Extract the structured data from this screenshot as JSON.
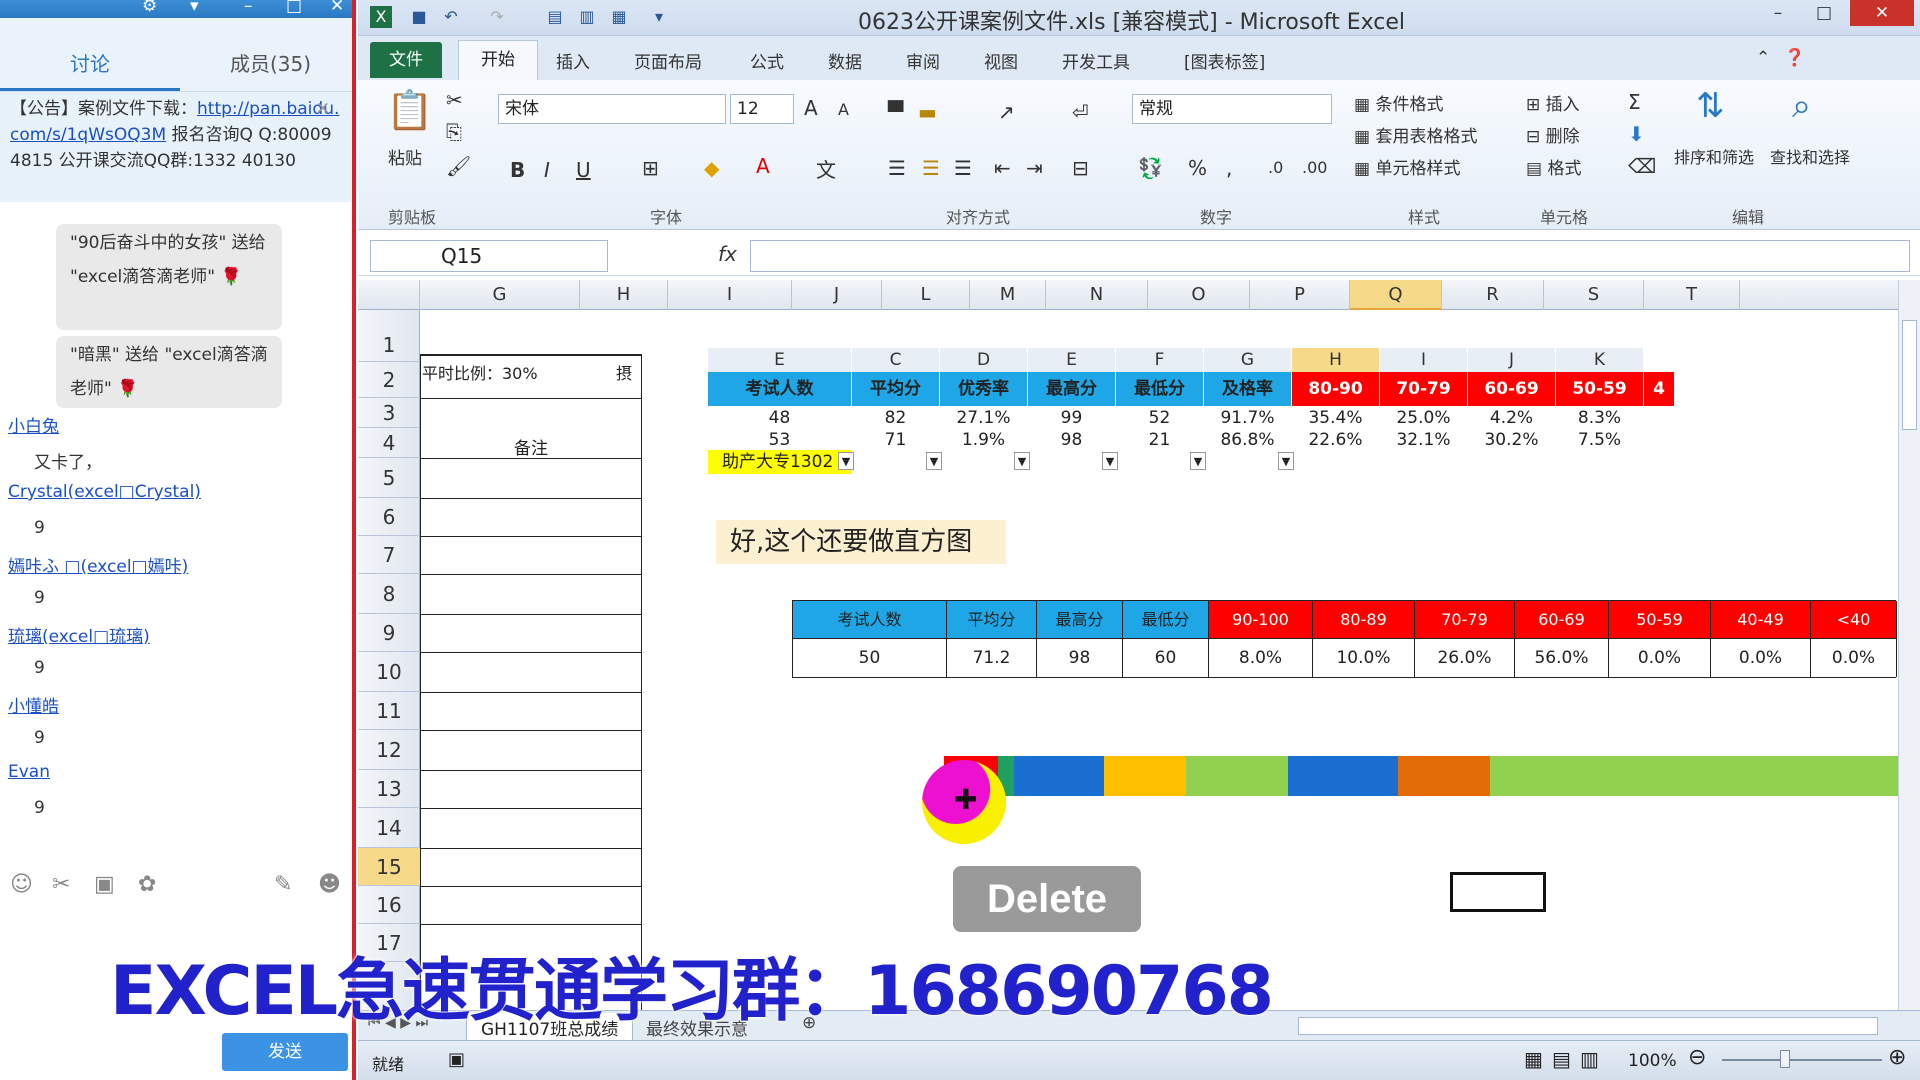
{
  "chat": {
    "tabs": [
      "讨论",
      "成员(35)"
    ],
    "notice_prefix": "【公告】案例文件下载：",
    "notice_link": "http://pan.baidu.com/s/1qWsOQ3M",
    "notice_rest": " 报名咨询Q Q:800094815 公开课交流QQ群:1332 40130",
    "bubble1": "\"90后奋斗中的女孩\" 送给 \"excel滴答滴老师\" 🌹",
    "bubble2": "\"暗黑\" 送给 \"excel滴答滴老师\" 🌹",
    "messages": [
      {
        "nick": "小白兔",
        "text": "又卡了，"
      },
      {
        "nick": "Crystal(excel□Crystal)",
        "text": "9"
      },
      {
        "nick": "嫣咔ふ □(excel□嫣咔)",
        "text": "9"
      },
      {
        "nick": "琉璃(excel□琉璃)",
        "text": "9"
      },
      {
        "nick": "小懂皓",
        "text": "9"
      },
      {
        "nick": "Evan",
        "text": "9"
      }
    ],
    "send_label": "发送"
  },
  "excel": {
    "title": "0623公开课案例文件.xls [兼容模式] - Microsoft Excel",
    "ribbon_tabs": [
      "文件",
      "开始",
      "插入",
      "页面布局",
      "公式",
      "数据",
      "审阅",
      "视图",
      "开发工具",
      "[图表标签]"
    ],
    "clipboard": {
      "paste": "粘贴",
      "group": "剪贴板"
    },
    "font": {
      "name": "宋体",
      "size": "12",
      "group": "字体"
    },
    "align_group": "对齐方式",
    "number": {
      "format": "常规",
      "group": "数字"
    },
    "styles": {
      "cond": "条件格式",
      "table": "套用表格格式",
      "cell": "单元格样式",
      "group": "样式"
    },
    "cells": {
      "insert": "插入",
      "delete": "删除",
      "format": "格式",
      "group": "单元格"
    },
    "editing": {
      "sort": "排序和筛选",
      "find": "查找和选择",
      "group": "编辑"
    },
    "name_box": "Q15",
    "fx": "fx",
    "columns": [
      "G",
      "H",
      "I",
      "J",
      "L",
      "M",
      "N",
      "O",
      "P",
      "Q",
      "R",
      "S",
      "T"
    ],
    "selected_column": "Q",
    "rows": [
      "1",
      "2",
      "3",
      "4",
      "5",
      "6",
      "7",
      "8",
      "9",
      "10",
      "11",
      "12",
      "13",
      "14",
      "15",
      "16",
      "17"
    ],
    "selected_row": "15",
    "left_table": {
      "ratio": "平时比例：30%",
      "tail": "摂",
      "note": "备注"
    },
    "table1": {
      "letters": [
        "E",
        "C",
        "D",
        "E",
        "F",
        "G",
        "H",
        "I",
        "J",
        "K"
      ],
      "headers": [
        "考试人数",
        "平均分",
        "优秀率",
        "最高分",
        "最低分",
        "及格率",
        "80-90",
        "70-79",
        "60-69",
        "50-59"
      ],
      "row1": [
        "48",
        "82",
        "27.1%",
        "99",
        "52",
        "91.7%",
        "35.4%",
        "25.0%",
        "4.2%",
        "8.3%"
      ],
      "row2": [
        "53",
        "71",
        "1.9%",
        "98",
        "21",
        "86.8%",
        "22.6%",
        "32.1%",
        "30.2%",
        "7.5%"
      ],
      "filter_label": "助产大专1302",
      "edge_digit": "4"
    },
    "annotation": "好,这个还要做直方图",
    "table2": {
      "headers": [
        "考试人数",
        "平均分",
        "最高分",
        "最低分",
        "90-100",
        "80-89",
        "70-79",
        "60-69",
        "50-59",
        "40-49",
        "<40"
      ],
      "values": [
        "50",
        "71.2",
        "98",
        "60",
        "8.0%",
        "10.0%",
        "26.0%",
        "56.0%",
        "0.0%",
        "0.0%",
        "0.0%"
      ]
    },
    "sheet_tabs": [
      "GH1107班总成绩",
      "最终效果示意"
    ],
    "status_ready": "就绪",
    "zoom": "100%"
  },
  "overlay": {
    "banner": "EXCEL急速贯通学习群：168690768",
    "key": "Delete"
  },
  "colors": {
    "header_blue": "#1fa6e6",
    "header_red": "#ff0000",
    "filter_yellow": "#ffff00",
    "annotation_bg": "#fdf0d0",
    "excel_green": "#1e7145"
  }
}
